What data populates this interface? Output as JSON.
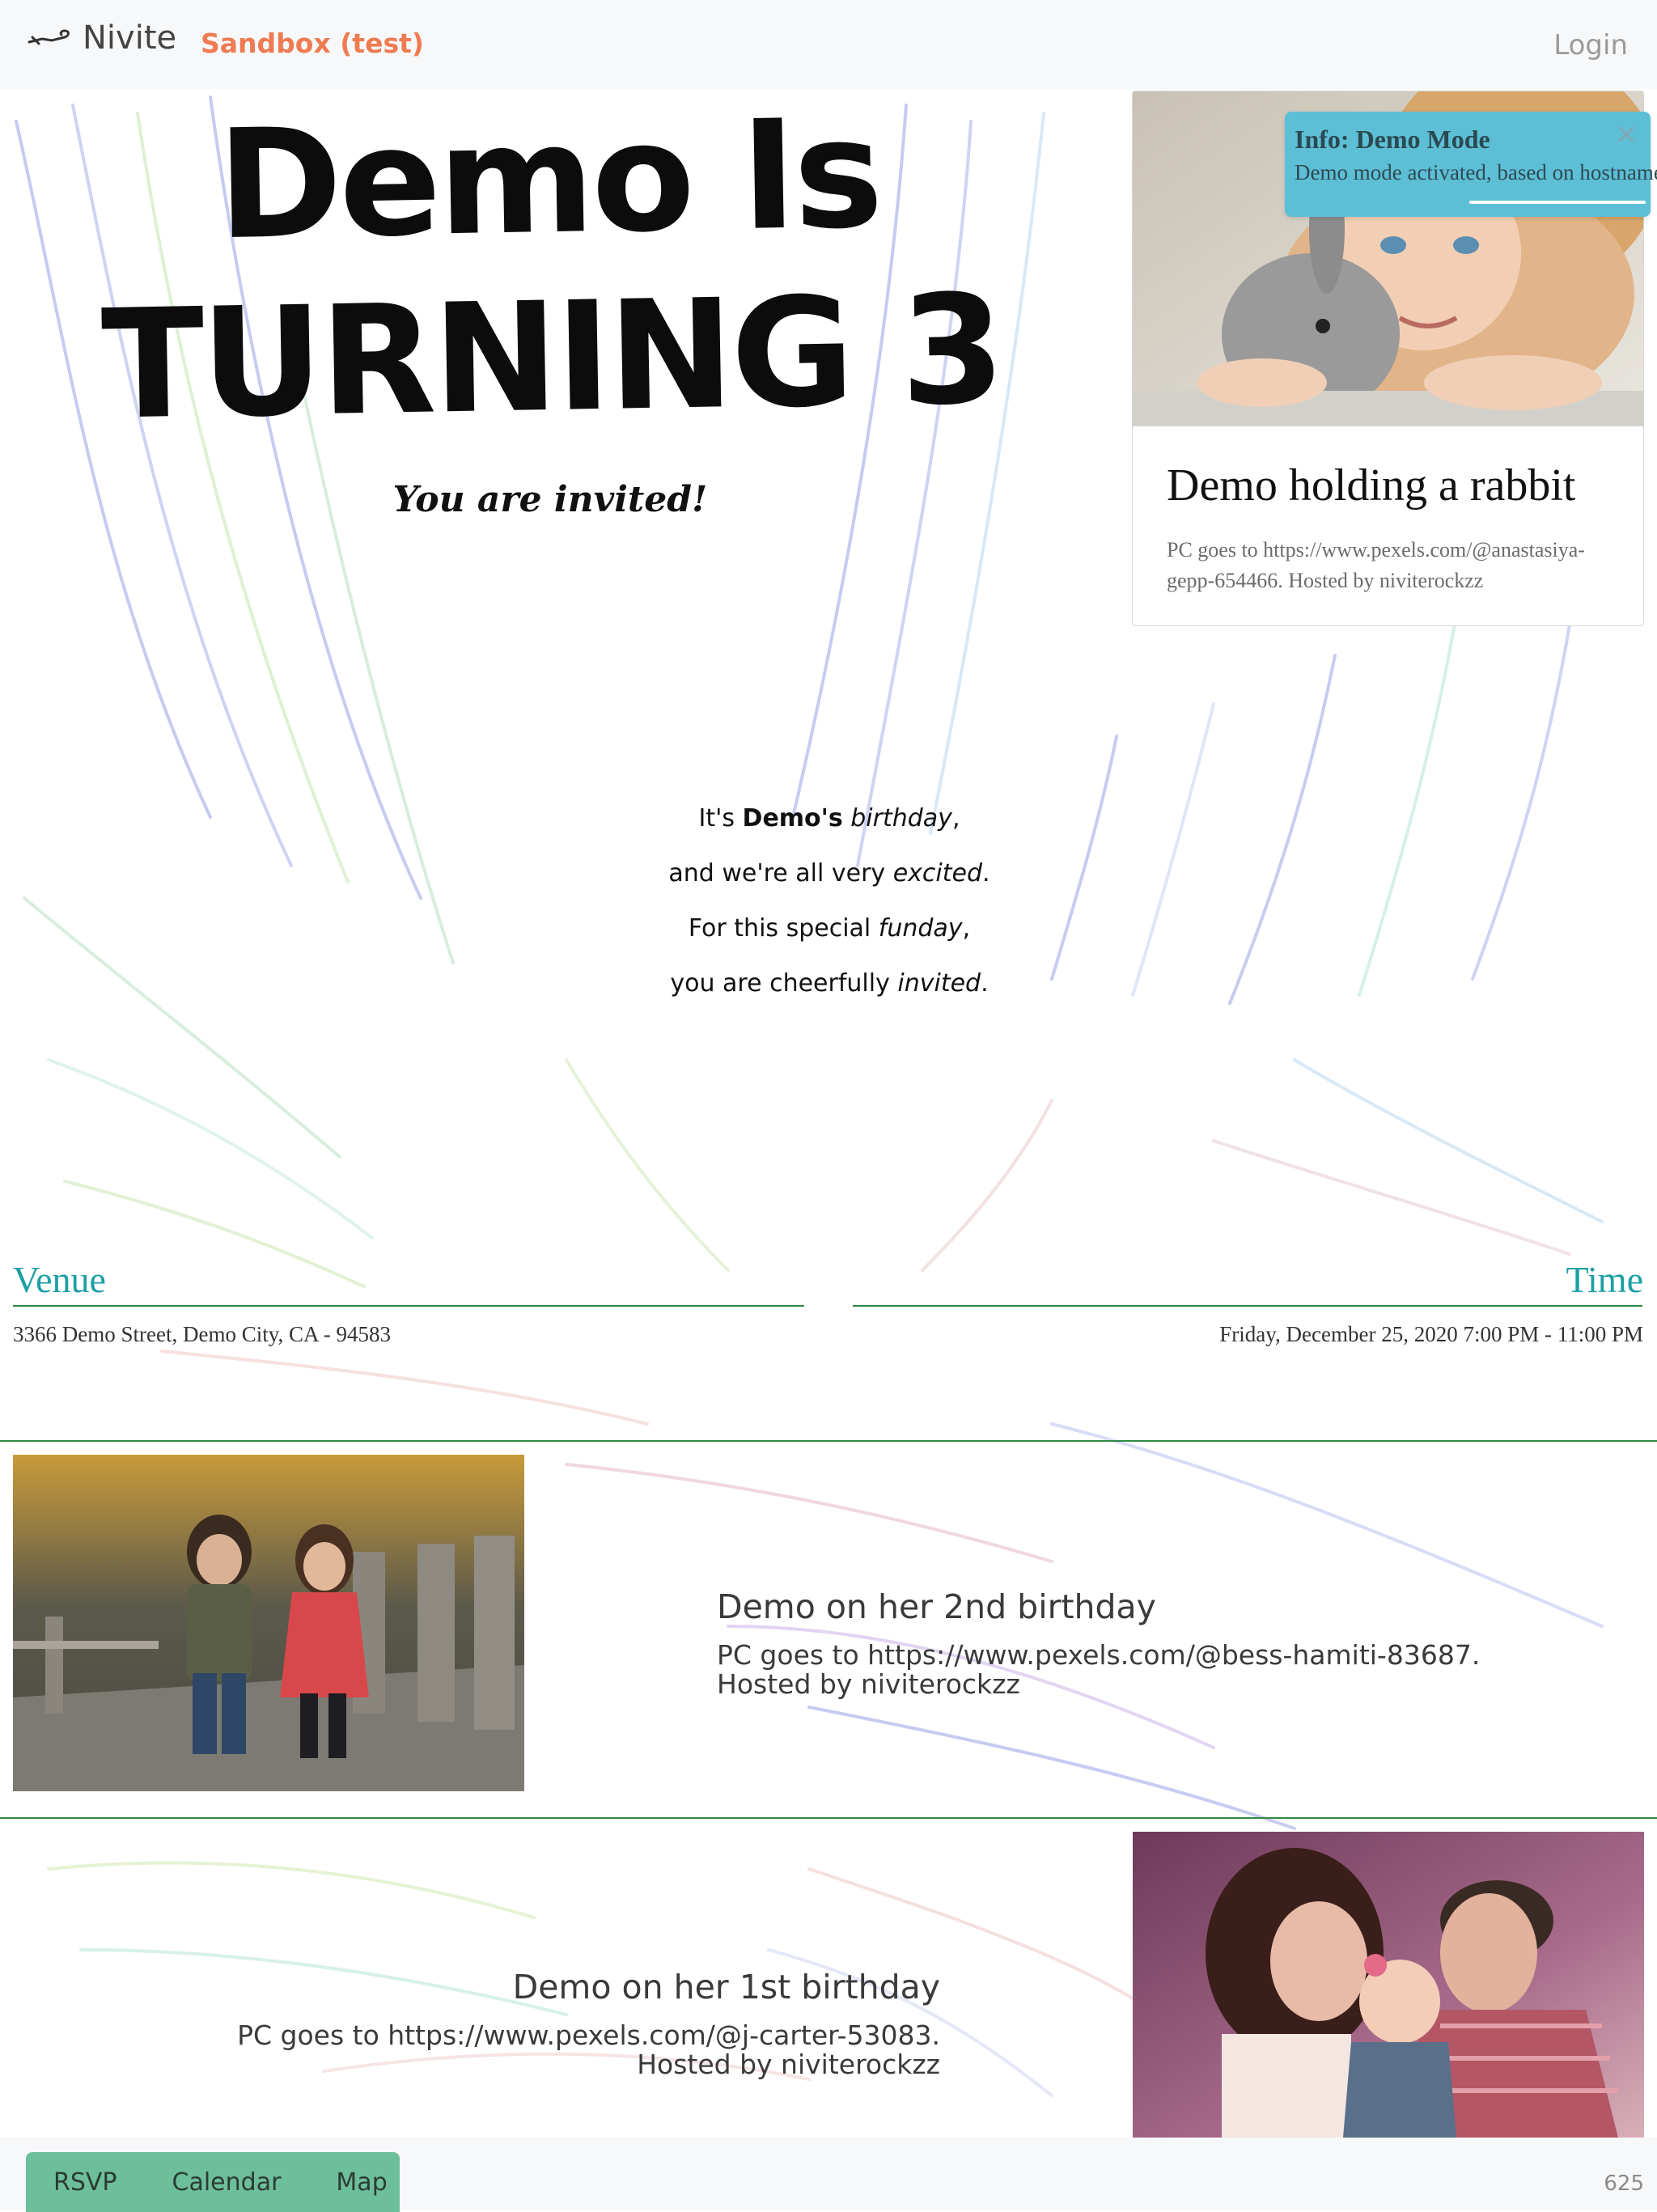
{
  "navbar": {
    "brand": "Nivite",
    "environment": "Sandbox (test)",
    "login": "Login"
  },
  "hero": {
    "title_line1": "Demo is",
    "title_line2": "turning 3",
    "subtitle": "You are invited!"
  },
  "poem": {
    "line1": {
      "a": "It's ",
      "b": "Demo's",
      "c": " ",
      "d": "birthday",
      "e": ","
    },
    "line2": {
      "a": "and we're all very ",
      "b": "excited",
      "c": "."
    },
    "line3": {
      "a": "For this special ",
      "b": "funday",
      "c": ","
    },
    "line4": {
      "a": "you are cheerfully ",
      "b": "invited",
      "c": "."
    }
  },
  "toast": {
    "title": "Info: Demo Mode",
    "body": "Demo mode activated, based on hostname",
    "close_icon": "close-icon"
  },
  "featured_card": {
    "title": "Demo holding a rabbit",
    "caption": "PC goes to https://www.pexels.com/@anastasiya-gepp-654466. Hosted by niviterockzz"
  },
  "venue": {
    "heading": "Venue",
    "address": "3366 Demo Street, Demo City, CA - 94583"
  },
  "time": {
    "heading": "Time",
    "value": "Friday, December 25, 2020 7:00 PM - 11:00 PM"
  },
  "photos": [
    {
      "title": "Demo on her 2nd birthday",
      "caption_line1": "PC goes to https://www.pexels.com/@bess-hamiti-83687.",
      "caption_line2": "Hosted by niviterockzz"
    },
    {
      "title": "Demo on her 1st birthday",
      "caption_line1": "PC goes to https://www.pexels.com/@j-carter-53083.",
      "caption_line2": "Hosted by niviterockzz"
    }
  ],
  "bottom_bar": {
    "rsvp": "RSVP",
    "calendar": "Calendar",
    "map": "Map",
    "counter": "625"
  },
  "colors": {
    "brand_accent": "#ee7b52",
    "heading_teal": "#1b9fa5",
    "rule_green": "#2f8a42",
    "toast_bg": "#5cbfd6",
    "button_green": "#6dbf9c"
  }
}
